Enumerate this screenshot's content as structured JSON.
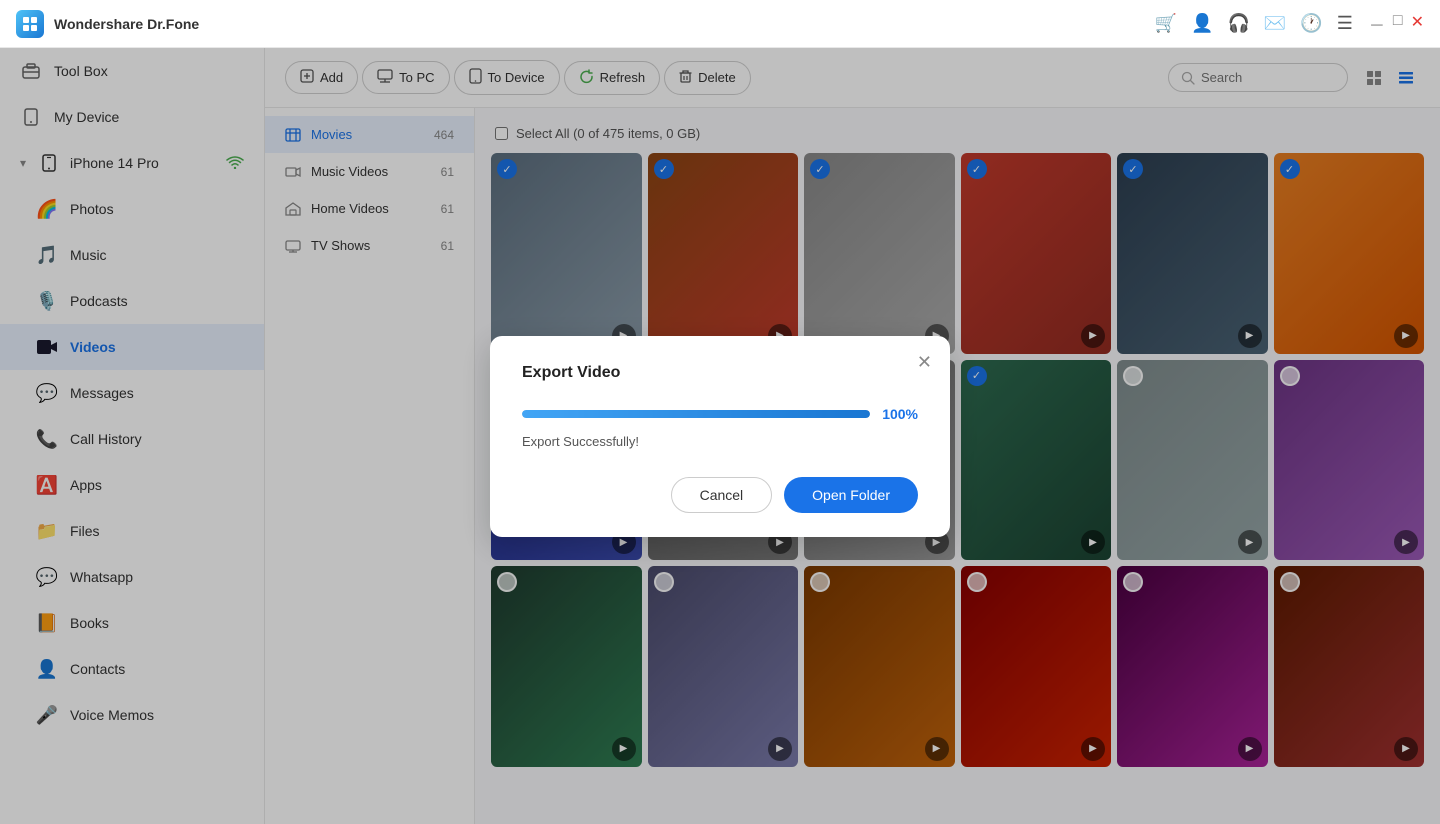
{
  "app": {
    "name": "Wondershare Dr.Fone",
    "logo_text": "W"
  },
  "title_bar": {
    "icons": [
      "cart",
      "user",
      "headphones",
      "mail",
      "clock",
      "list"
    ],
    "window_controls": [
      "minimize",
      "maximize",
      "close"
    ]
  },
  "sidebar": {
    "items": [
      {
        "id": "toolbox",
        "label": "Tool Box",
        "icon": "🏠"
      },
      {
        "id": "my-device",
        "label": "My Device",
        "icon": "📱"
      }
    ],
    "device": {
      "name": "iPhone 14 Pro",
      "wifi": true,
      "sub_items": [
        {
          "id": "photos",
          "label": "Photos",
          "icon": "🌈"
        },
        {
          "id": "music",
          "label": "Music",
          "icon": "🎵"
        },
        {
          "id": "podcasts",
          "label": "Podcasts",
          "icon": "🎙️"
        },
        {
          "id": "videos",
          "label": "Videos",
          "icon": "📺",
          "active": true
        },
        {
          "id": "messages",
          "label": "Messages",
          "icon": "💬"
        },
        {
          "id": "call-history",
          "label": "Call History",
          "icon": "📞"
        },
        {
          "id": "apps",
          "label": "Apps",
          "icon": "🅰️"
        },
        {
          "id": "files",
          "label": "Files",
          "icon": "📁"
        },
        {
          "id": "whatsapp",
          "label": "Whatsapp",
          "icon": "💚"
        },
        {
          "id": "books",
          "label": "Books",
          "icon": "📙"
        },
        {
          "id": "contacts",
          "label": "Contacts",
          "icon": "👤"
        },
        {
          "id": "voice-memos",
          "label": "Voice Memos",
          "icon": "🎤"
        }
      ]
    }
  },
  "toolbar": {
    "add_label": "Add",
    "to_pc_label": "To PC",
    "to_device_label": "To Device",
    "refresh_label": "Refresh",
    "delete_label": "Delete",
    "search_placeholder": "Search"
  },
  "sub_nav": {
    "items": [
      {
        "id": "movies",
        "label": "Movies",
        "count": "464",
        "active": true
      },
      {
        "id": "music-videos",
        "label": "Music Videos",
        "count": "61"
      },
      {
        "id": "home-videos",
        "label": "Home Videos",
        "count": "61"
      },
      {
        "id": "tv-shows",
        "label": "TV Shows",
        "count": "61"
      }
    ]
  },
  "grid": {
    "select_all_label": "Select All (0 of 475 items, 0 GB)",
    "thumbs": [
      {
        "id": 1,
        "checked": true,
        "cls": "thumb-1"
      },
      {
        "id": 2,
        "checked": true,
        "cls": "thumb-2"
      },
      {
        "id": 3,
        "checked": true,
        "cls": "thumb-3"
      },
      {
        "id": 4,
        "checked": true,
        "cls": "thumb-4"
      },
      {
        "id": 5,
        "checked": true,
        "cls": "thumb-5"
      },
      {
        "id": 6,
        "checked": true,
        "cls": "thumb-6"
      },
      {
        "id": 7,
        "checked": true,
        "cls": "thumb-7"
      },
      {
        "id": 8,
        "checked": false,
        "cls": "thumb-8"
      },
      {
        "id": 9,
        "checked": false,
        "cls": "thumb-9"
      },
      {
        "id": 10,
        "checked": true,
        "cls": "thumb-10"
      },
      {
        "id": 11,
        "checked": false,
        "cls": "thumb-11"
      },
      {
        "id": 12,
        "checked": false,
        "cls": "thumb-12"
      },
      {
        "id": 13,
        "checked": false,
        "cls": "thumb-13"
      },
      {
        "id": 14,
        "checked": false,
        "cls": "thumb-14"
      },
      {
        "id": 15,
        "checked": false,
        "cls": "thumb-15"
      },
      {
        "id": 16,
        "checked": false,
        "cls": "thumb-16"
      },
      {
        "id": 17,
        "checked": false,
        "cls": "thumb-17"
      },
      {
        "id": 18,
        "checked": false,
        "cls": "thumb-18"
      }
    ]
  },
  "modal": {
    "title": "Export Video",
    "progress_pct": 100,
    "progress_label": "100%",
    "status_text": "Export Successfully!",
    "cancel_label": "Cancel",
    "open_folder_label": "Open Folder"
  }
}
